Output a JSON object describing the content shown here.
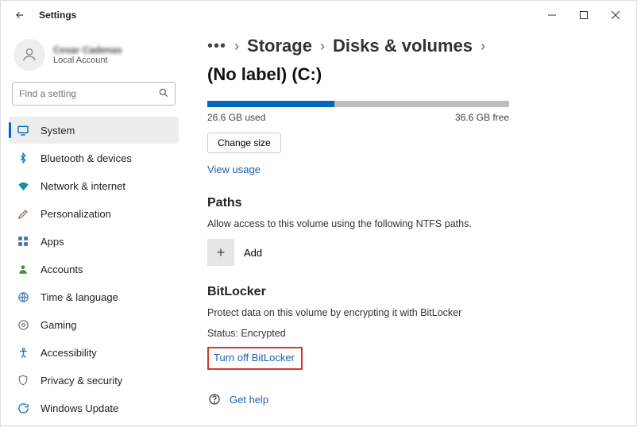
{
  "window": {
    "title": "Settings"
  },
  "user": {
    "name": "Cesar Cadenas",
    "subtitle": "Local Account"
  },
  "search": {
    "placeholder": "Find a setting"
  },
  "nav": {
    "items": [
      {
        "label": "System"
      },
      {
        "label": "Bluetooth & devices"
      },
      {
        "label": "Network & internet"
      },
      {
        "label": "Personalization"
      },
      {
        "label": "Apps"
      },
      {
        "label": "Accounts"
      },
      {
        "label": "Time & language"
      },
      {
        "label": "Gaming"
      },
      {
        "label": "Accessibility"
      },
      {
        "label": "Privacy & security"
      },
      {
        "label": "Windows Update"
      }
    ]
  },
  "breadcrumb": {
    "items": [
      {
        "label": "Storage"
      },
      {
        "label": "Disks & volumes"
      },
      {
        "label": "(No label) (C:)"
      }
    ]
  },
  "storage": {
    "used_label": "26.6 GB used",
    "free_label": "36.6 GB free",
    "used_percent": 42,
    "change_size_btn": "Change size",
    "view_usage_link": "View usage"
  },
  "paths": {
    "title": "Paths",
    "description": "Allow access to this volume using the following NTFS paths.",
    "add_label": "Add"
  },
  "bitlocker": {
    "title": "BitLocker",
    "description": "Protect data on this volume by encrypting it with BitLocker",
    "status_label": "Status: Encrypted",
    "turn_off_link": "Turn off BitLocker"
  },
  "help": {
    "label": "Get help"
  }
}
